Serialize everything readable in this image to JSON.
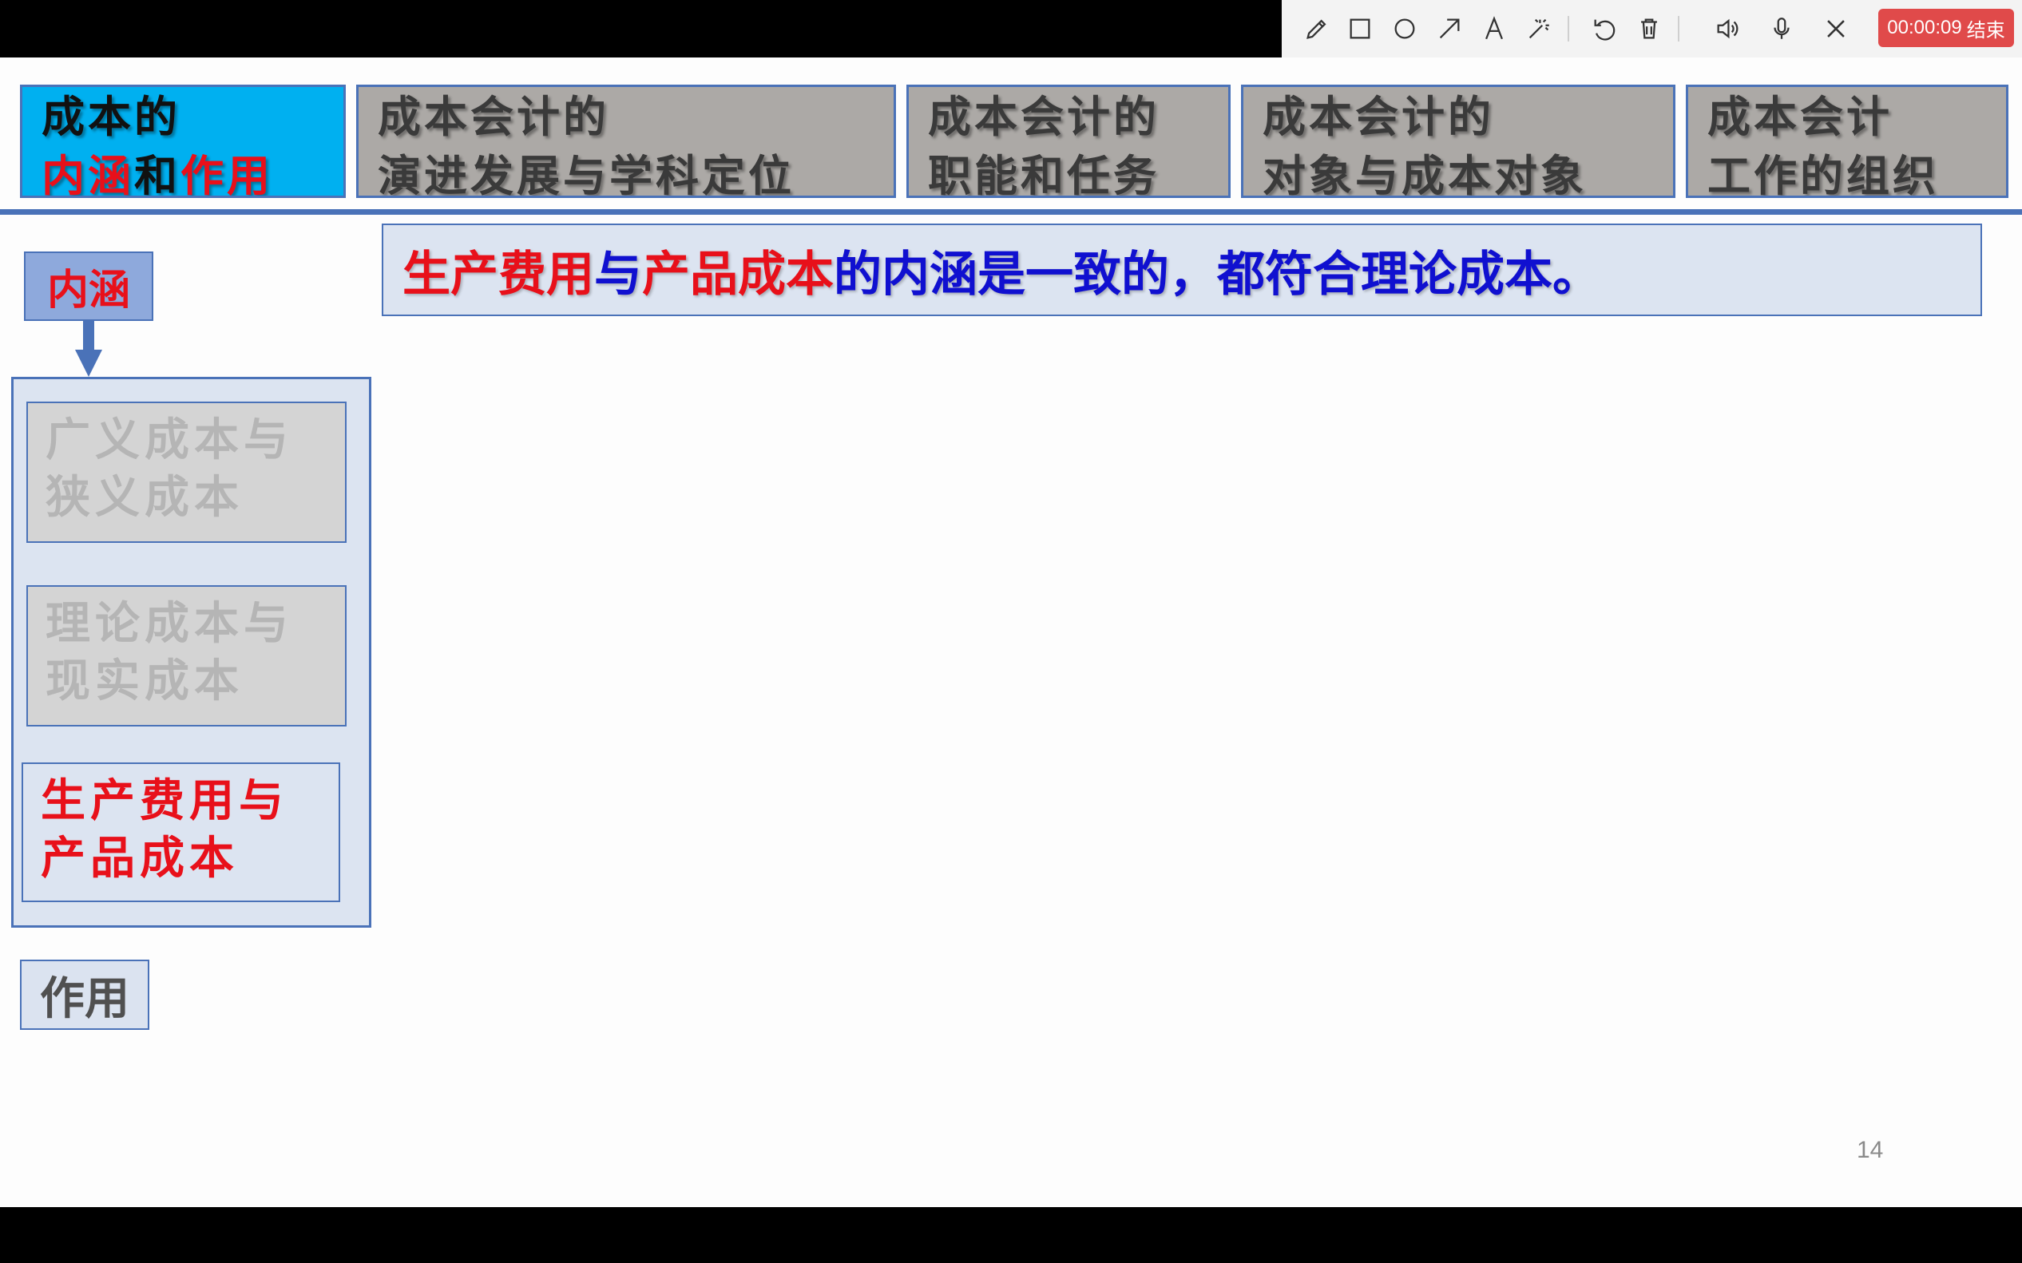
{
  "toolbar": {
    "tools": [
      "pen-icon",
      "rectangle-icon",
      "circle-icon",
      "arrow-icon",
      "text-icon",
      "laser-pointer-icon",
      "undo-icon",
      "trash-icon",
      "speaker-icon",
      "microphone-icon",
      "close-icon"
    ],
    "timer": "00:00:09",
    "end_label": "结束",
    "timer_color": "#e04a4a"
  },
  "tabs": [
    {
      "line1": "成本的",
      "line2_parts": [
        "内涵",
        "和",
        "作用"
      ],
      "active": true
    },
    {
      "line1": "成本会计的",
      "line2": "演进发展与学科定位",
      "active": false
    },
    {
      "line1": "成本会计的",
      "line2": "职能和任务",
      "active": false
    },
    {
      "line1": "成本会计的",
      "line2": "对象与成本对象",
      "active": false
    },
    {
      "line1": "成本会计",
      "line2": "工作的组织",
      "active": false
    }
  ],
  "sidebar": {
    "neihan_label": "内涵",
    "items": [
      {
        "line1": "广义成本与",
        "line2": "狭义成本",
        "active": false
      },
      {
        "line1": "理论成本与",
        "line2": "现实成本",
        "active": false
      },
      {
        "line1": "生产费用与",
        "line2": "产品成本",
        "active": true
      }
    ],
    "zuoyong_label": "作用"
  },
  "statement": {
    "part1": "生产费用",
    "part2": "与",
    "part3": "产品成本",
    "part4": "的内涵是一致的，都符合理论成本。"
  },
  "page_number": "14",
  "colors": {
    "accent": "#4a72b8",
    "active_tab": "#00b0f0",
    "highlight_red": "#e8101a",
    "highlight_blue": "#1010d0"
  }
}
